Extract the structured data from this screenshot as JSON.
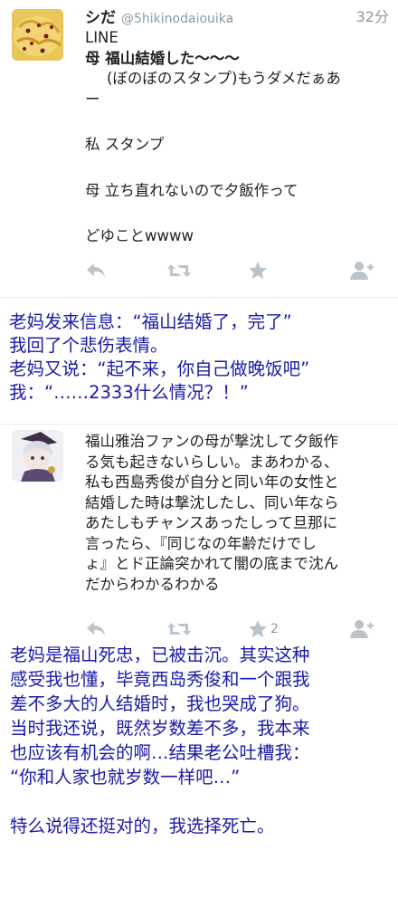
{
  "tweet1": {
    "name": "シだ",
    "handle": "@5hikinodaiouika",
    "time": "32分",
    "lines": [
      "LINE",
      "母 福山結婚した〜〜〜",
      "(ぼのぼのスタンプ)もうダメだぁあ",
      "ー",
      "私 スタンプ",
      "母 立ち直れないので夕飯作って",
      "どゆことwwww"
    ]
  },
  "caption1": [
    "老妈发来信息：“福山结婚了，完了”",
    "我回了个悲伤表情。",
    "老妈又说：“起不来，你自己做晚饭吧”",
    "我：“……2333什么情况？！”"
  ],
  "tweet2": {
    "lines": [
      "福山雅治ファンの母が撃沈して夕飯作",
      "る気も起きないらしい。まあわかる、",
      "私も西島秀俊が自分と同い年の女性と",
      "結婚した時は撃沈したし、同い年なら",
      "あたしもチャンスあったしって旦那に",
      "言ったら、『同じなの年齢だけでし",
      "ょ』とド正論突かれて闇の底まで沈ん",
      "だからわかるわかる"
    ],
    "like_count": "2"
  },
  "caption2": [
    "老妈是福山死忠，已被击沉。其实这种",
    "感受我也懂，毕竟西岛秀俊和一个跟我",
    "差不多大的人结婚时，我也哭成了狗。",
    "当时我还说，既然岁数差不多，我本来",
    "也应该有机会的啊…结果老公吐槽我：",
    "“你和人家也就岁数一样吧…”",
    "",
    "特么说得还挺对的，我选择死亡。"
  ],
  "icons": [
    "reply-icon",
    "retweet-icon",
    "star-icon",
    "follow-icon"
  ],
  "colors": {
    "caption": "#1a1aa8",
    "icon": "#b8c3cc",
    "meta": "#8899a6"
  }
}
